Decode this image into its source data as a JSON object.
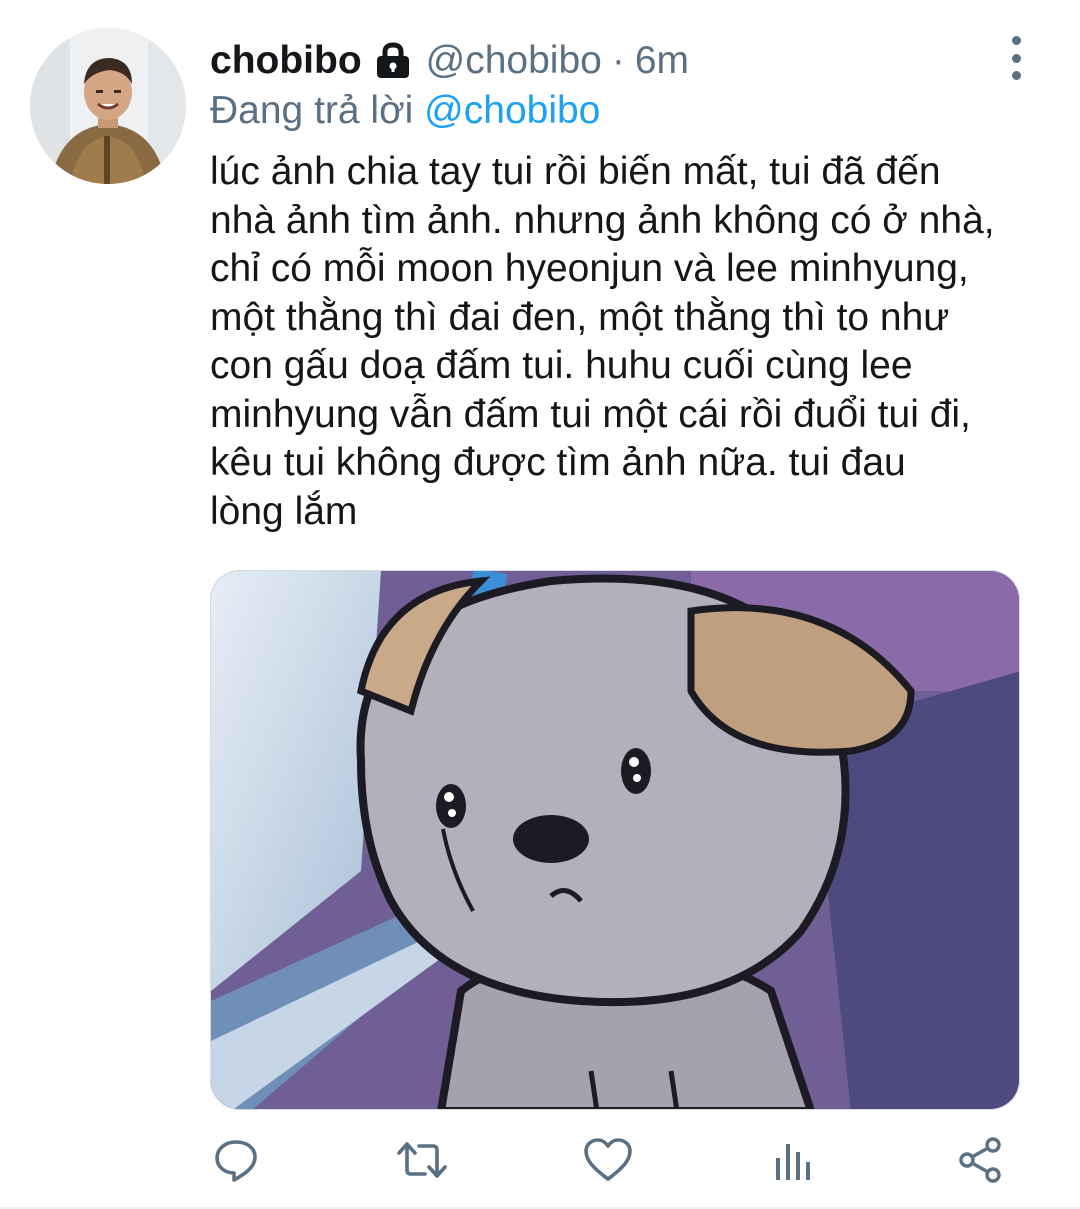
{
  "tweet": {
    "author": {
      "display_name": "chobibo",
      "handle": "@chobibo",
      "protected_icon": "lock-icon",
      "avatar_icon": "user-photo"
    },
    "separator": "·",
    "time": "6m",
    "reply_prefix": "Đang trả lời",
    "reply_to": "@chobibo",
    "text_lines": [
      "lúc ảnh chia tay tui rồi biến mất, tui đã đến",
      "nhà ảnh tìm ảnh. nhưng ảnh không có ở nhà,",
      "chỉ có mỗi moon hyeonjun và lee minhyung,",
      "một thằng thì đai đen, một thằng thì to như",
      "con gấu doạ đấm tui. huhu cuối cùng lee",
      "minhyung vẫn đấm tui một cái rồi đuổi tui đi,",
      "kêu tui không được tìm ảnh nữa. tui đau",
      "lòng lắm"
    ],
    "media_description_icon": "sad-cartoon-dog-image",
    "actions": {
      "reply_icon": "reply-icon",
      "retweet_icon": "retweet-icon",
      "like_icon": "heart-icon",
      "analytics_icon": "analytics-icon",
      "share_icon": "share-icon"
    }
  },
  "colors": {
    "text": "#14171a",
    "secondary": "#5b7083",
    "accent": "#1da1f2"
  }
}
